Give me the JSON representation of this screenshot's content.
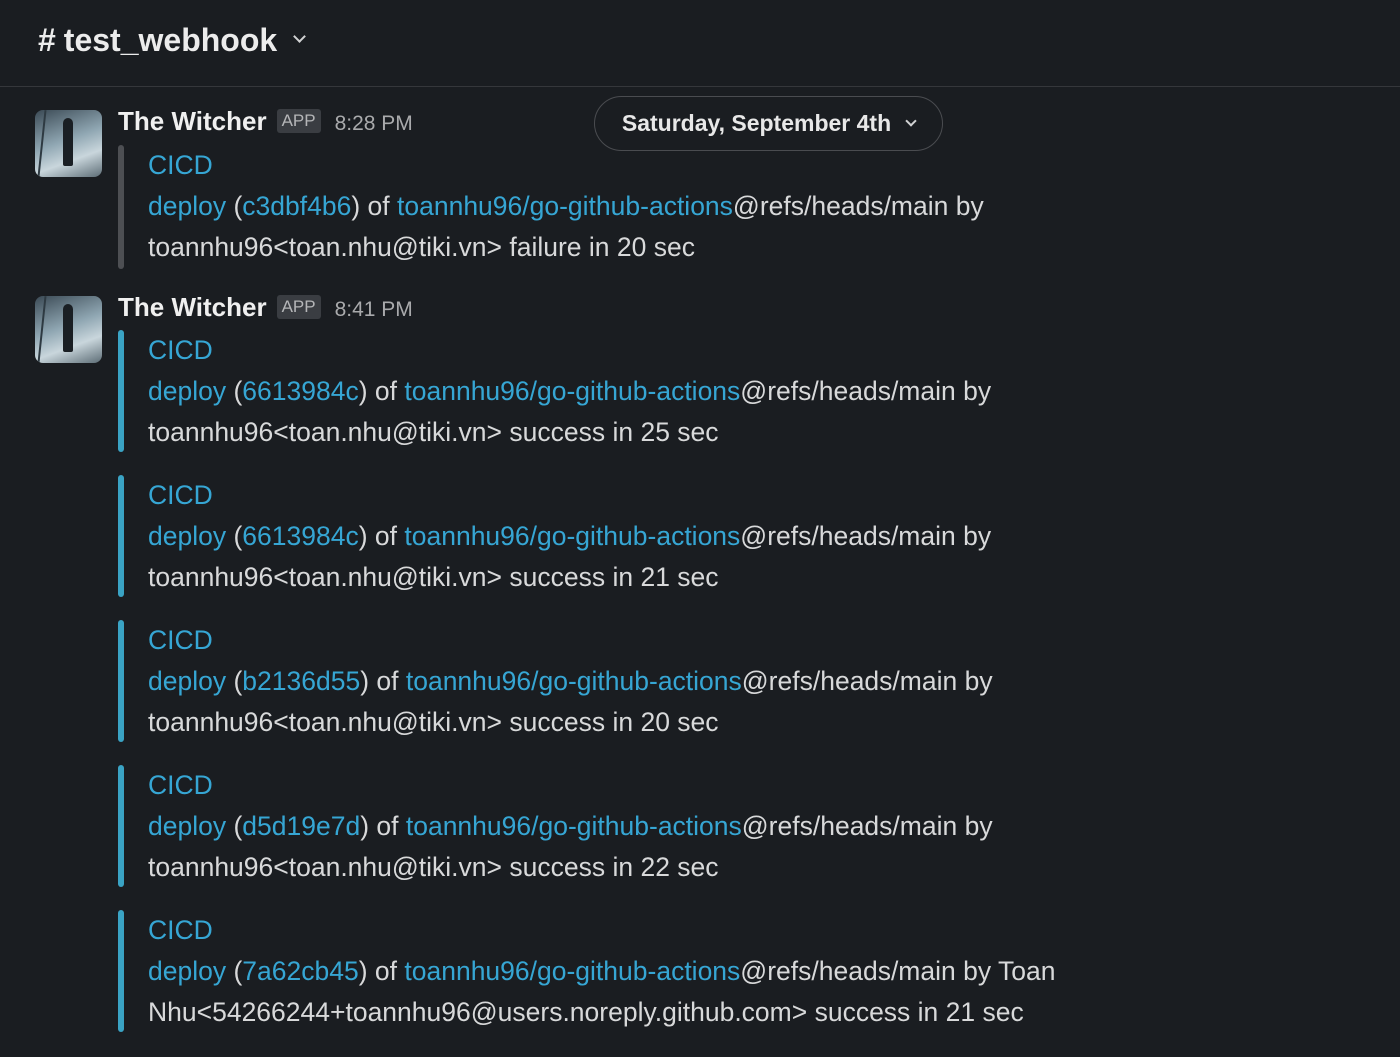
{
  "channel": {
    "hash": "#",
    "name": "test_webhook"
  },
  "date_divider": "Saturday, September 4th",
  "messages": [
    {
      "sender": "The Witcher",
      "badge": "APP",
      "time": "8:28 PM",
      "attachments": [
        {
          "status": "failure",
          "title": "CICD",
          "deploy": "deploy",
          "open_paren": "(",
          "commit": "c3dbf4b6",
          "mid": ") of ",
          "repo": "toannhu96/go-github-actions",
          "ref_by": "@refs/heads/main by",
          "line2": "toannhu96<toan.nhu@tiki.vn> failure in 20 sec"
        }
      ]
    },
    {
      "sender": "The Witcher",
      "badge": "APP",
      "time": "8:41 PM",
      "attachments": [
        {
          "status": "success",
          "title": "CICD",
          "deploy": "deploy",
          "open_paren": "(",
          "commit": "6613984c",
          "mid": ") of ",
          "repo": "toannhu96/go-github-actions",
          "ref_by": "@refs/heads/main by",
          "line2": "toannhu96<toan.nhu@tiki.vn> success in 25 sec"
        },
        {
          "status": "success",
          "title": "CICD",
          "deploy": "deploy",
          "open_paren": "(",
          "commit": "6613984c",
          "mid": ") of ",
          "repo": "toannhu96/go-github-actions",
          "ref_by": "@refs/heads/main by",
          "line2": "toannhu96<toan.nhu@tiki.vn> success in 21 sec"
        },
        {
          "status": "success",
          "title": "CICD",
          "deploy": "deploy",
          "open_paren": "(",
          "commit": "b2136d55",
          "mid": ") of ",
          "repo": "toannhu96/go-github-actions",
          "ref_by": "@refs/heads/main by",
          "line2": "toannhu96<toan.nhu@tiki.vn> success in 20 sec"
        },
        {
          "status": "success",
          "title": "CICD",
          "deploy": "deploy",
          "open_paren": "(",
          "commit": "d5d19e7d",
          "mid": ") of ",
          "repo": "toannhu96/go-github-actions",
          "ref_by": "@refs/heads/main by",
          "line2": "toannhu96<toan.nhu@tiki.vn> success in 22 sec"
        },
        {
          "status": "success",
          "title": "CICD",
          "deploy": "deploy",
          "open_paren": "(",
          "commit": "7a62cb45",
          "mid": ") of ",
          "repo": "toannhu96/go-github-actions",
          "ref_by": "@refs/heads/main by Toan",
          "line2": "Nhu<54266244+toannhu96@users.noreply.github.com> success in 21 sec"
        }
      ]
    }
  ],
  "icons": {
    "channel_chevron": "chevron-down-icon",
    "date_chevron": "chevron-down-icon",
    "avatar": "witcher-avatar"
  },
  "colors": {
    "background": "#1a1d21",
    "link": "#36a6d4",
    "success_bar": "#3aa3c4",
    "failure_bar": "#4d4f53"
  }
}
